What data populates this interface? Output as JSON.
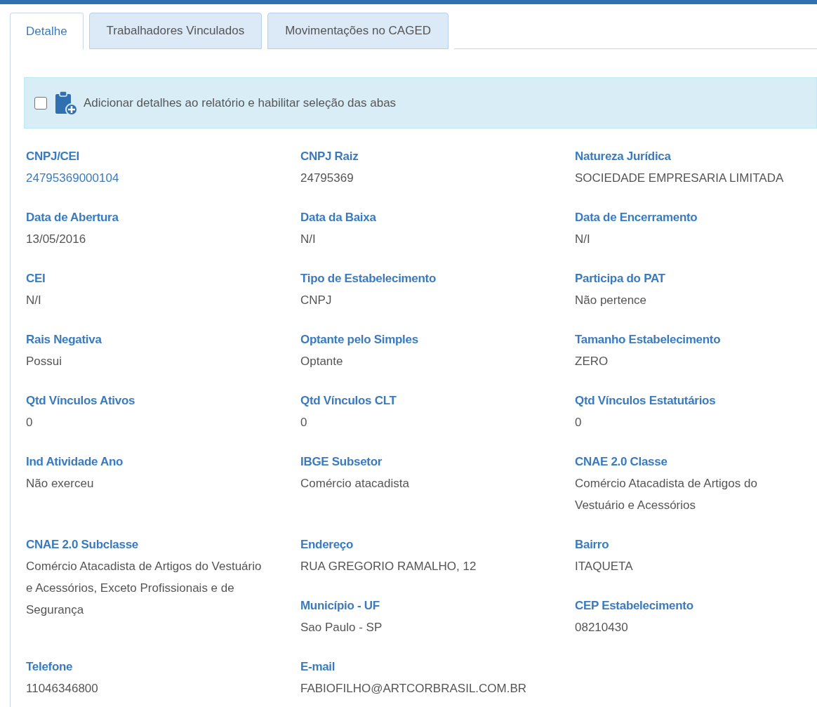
{
  "tabs": [
    {
      "label": "Detalhe",
      "selected": true
    },
    {
      "label": "Trabalhadores Vinculados",
      "selected": false
    },
    {
      "label": "Movimentações no CAGED",
      "selected": false
    }
  ],
  "report_option": {
    "checked": false,
    "label": "Adicionar detalhes ao relatório e habilitar seleção das abas"
  },
  "rows": [
    [
      [
        {
          "label": "CNPJ/CEI",
          "value": "24795369000104",
          "kind": "link"
        }
      ],
      [
        {
          "label": "CNPJ Raiz",
          "value": "24795369",
          "kind": "text"
        }
      ],
      [
        {
          "label": "Natureza Jurídica",
          "value": "SOCIEDADE EMPRESARIA LIMITADA",
          "kind": "text"
        }
      ]
    ],
    [
      [
        {
          "label": "Data de Abertura",
          "value": "13/05/2016",
          "kind": "text"
        }
      ],
      [
        {
          "label": "Data da Baixa",
          "value": "N/I",
          "kind": "text"
        }
      ],
      [
        {
          "label": "Data de Encerramento",
          "value": "N/I",
          "kind": "text"
        }
      ]
    ],
    [
      [
        {
          "label": "CEI",
          "value": "N/I",
          "kind": "text"
        }
      ],
      [
        {
          "label": "Tipo de Estabelecimento",
          "value": "CNPJ",
          "kind": "text"
        }
      ],
      [
        {
          "label": "Participa do PAT",
          "value": "Não pertence",
          "kind": "text"
        }
      ]
    ],
    [
      [
        {
          "label": "Rais Negativa",
          "value": "Possui",
          "kind": "text"
        }
      ],
      [
        {
          "label": "Optante pelo Simples",
          "value": "Optante",
          "kind": "text"
        }
      ],
      [
        {
          "label": "Tamanho Estabelecimento",
          "value": "ZERO",
          "kind": "text"
        }
      ]
    ],
    [
      [
        {
          "label": "Qtd Vínculos Ativos",
          "value": "0",
          "kind": "text"
        }
      ],
      [
        {
          "label": "Qtd Vínculos CLT",
          "value": "0",
          "kind": "text"
        }
      ],
      [
        {
          "label": "Qtd Vínculos Estatutários",
          "value": "0",
          "kind": "text"
        }
      ]
    ],
    [
      [
        {
          "label": "Ind Atividade Ano",
          "value": "Não exerceu",
          "kind": "text"
        }
      ],
      [
        {
          "label": "IBGE Subsetor",
          "value": "Comércio atacadista",
          "kind": "text"
        }
      ],
      [
        {
          "label": "CNAE 2.0 Classe",
          "value": "Comércio Atacadista de Artigos do Vestuário e Acessórios",
          "kind": "text"
        }
      ]
    ],
    [
      [
        {
          "label": "CNAE 2.0 Subclasse",
          "value": "Comércio Atacadista de Artigos do Vestuário e Acessórios, Exceto Profissionais e de Segurança",
          "kind": "text"
        }
      ],
      [
        {
          "label": "Endereço",
          "value": "RUA GREGORIO RAMALHO, 12",
          "kind": "text"
        },
        {
          "label": "Município - UF",
          "value": "Sao Paulo - SP",
          "kind": "text"
        }
      ],
      [
        {
          "label": "Bairro",
          "value": "ITAQUETA",
          "kind": "text"
        },
        {
          "label": "CEP Estabelecimento",
          "value": "08210430",
          "kind": "text"
        }
      ]
    ],
    [
      [
        {
          "label": "Telefone",
          "value": "11046346800",
          "kind": "text"
        }
      ],
      [
        {
          "label": "E-mail",
          "value": "FABIOFILHO@ARTCORBRASIL.COM.BR",
          "kind": "text"
        }
      ],
      []
    ]
  ]
}
